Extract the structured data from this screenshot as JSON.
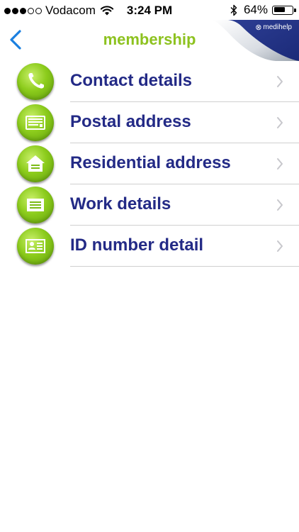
{
  "status_bar": {
    "carrier": "Vodacom",
    "time": "3:24 PM",
    "battery_percent": "64%",
    "battery_level": 0.64,
    "signal_bars_filled": 3,
    "signal_bars_total": 5
  },
  "nav": {
    "title": "membership",
    "back_icon": "chevron-left-icon",
    "brand": "medihelp",
    "accent_color": "#8dc21f",
    "back_color": "#1a7fe0"
  },
  "menu": {
    "label_color": "#232a86",
    "items": [
      {
        "label": "Contact details",
        "icon": "phone-icon"
      },
      {
        "label": "Postal address",
        "icon": "envelope-icon"
      },
      {
        "label": "Residential address",
        "icon": "house-icon"
      },
      {
        "label": "Work details",
        "icon": "document-icon"
      },
      {
        "label": "ID number detail",
        "icon": "id-card-icon"
      }
    ]
  }
}
